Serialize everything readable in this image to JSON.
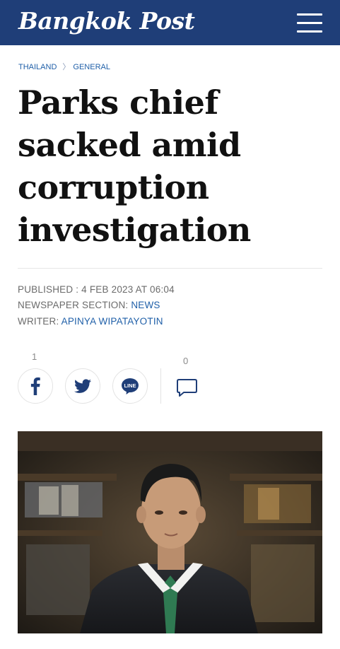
{
  "header": {
    "logo": "Bangkok Post",
    "menu_icon": "hamburger-menu-icon",
    "bg_color": "#1f3e78"
  },
  "breadcrumb": {
    "items": [
      "THAILAND",
      "GENERAL"
    ]
  },
  "article": {
    "title_lines": [
      "Parks chief",
      "sacked amid",
      "corruption",
      "investigation"
    ],
    "published_label": "PUBLISHED : 4 FEB 2023 AT 06:04",
    "section_label": "NEWSPAPER SECTION: ",
    "section_value": "NEWS",
    "writer_label": "WRITER: ",
    "writer_value": "APINYA WIPATAYOTIN"
  },
  "share": {
    "facebook_count": "1",
    "comment_count": "0",
    "buttons": [
      "facebook-icon",
      "twitter-icon",
      "line-icon",
      "comment-icon"
    ],
    "line_text": "LINE"
  },
  "colors": {
    "link": "#1f5fa8",
    "text": "#111111",
    "meta": "#6b6b6b"
  }
}
